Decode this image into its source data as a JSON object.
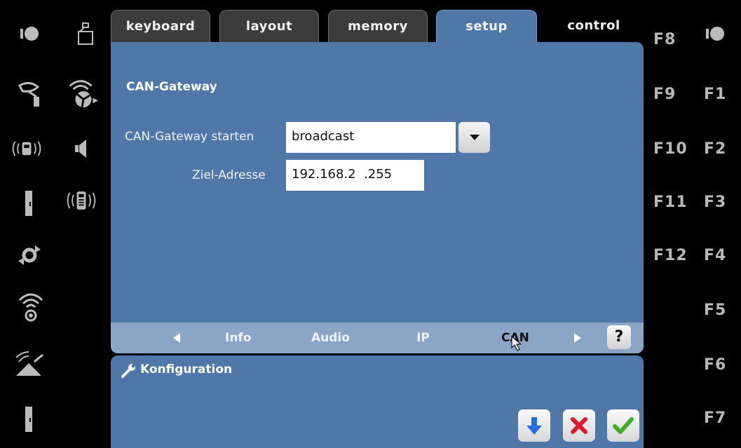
{
  "tabs": [
    {
      "label": "keyboard"
    },
    {
      "label": "layout"
    },
    {
      "label": "memory"
    },
    {
      "label": "setup"
    },
    {
      "label": "control"
    }
  ],
  "active_tab": "setup",
  "section": {
    "title": "CAN-Gateway"
  },
  "form": {
    "start_label": "CAN-Gateway starten",
    "start_value": "broadcast",
    "address_label": "Ziel-Adresse",
    "address_value": "192.168.2  .255"
  },
  "subnav": {
    "items": [
      "Info",
      "Audio",
      "IP",
      "CAN"
    ],
    "active": "CAN",
    "help_label": "?"
  },
  "bottom_panel": {
    "title": "Konfiguration"
  },
  "function_keys": {
    "left_column": [
      "F8",
      "F9",
      "F10",
      "F11",
      "F12"
    ],
    "right_column": [
      "F1",
      "F2",
      "F3",
      "F4",
      "F5",
      "F6",
      "F7"
    ]
  },
  "icons": {
    "left_col1": [
      "light-icon",
      "signal-horn-icon",
      "radio-loco-icon",
      "door-icon",
      "rotate-icon",
      "wireless-icon",
      "signal-dish-icon",
      "door-icon"
    ],
    "left_col2": [
      "bell-icon",
      "wireless-fan-icon",
      "speaker-icon",
      "radio-phone-icon"
    ],
    "right_top": "light-icon"
  },
  "colors": {
    "panel": "#4f78a8",
    "subnav": "#8aa5c6",
    "tab_inactive": "#3c3c3c",
    "down_arrow": "#1f6fe0",
    "cancel": "#e0182a",
    "confirm": "#3fae2a"
  }
}
